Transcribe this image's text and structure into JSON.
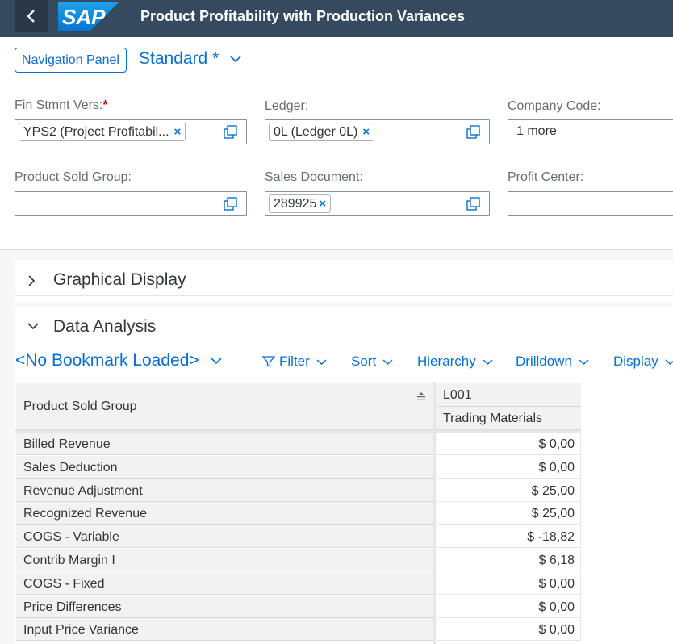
{
  "shell": {
    "back_icon": "chevron-left-icon",
    "logo_text": "SAP",
    "title": "Product Profitability with Production Variances"
  },
  "variant_bar": {
    "nav_panel_label": "Navigation Panel",
    "variant_name": "Standard *"
  },
  "filters": {
    "fin_stmnt": {
      "label": "Fin Stmnt Vers:",
      "required_mark": "*",
      "token": "YPS2 (Project Profitabil..."
    },
    "ledger": {
      "label": "Ledger:",
      "token": "0L (Ledger 0L)"
    },
    "company_code": {
      "label": "Company Code:",
      "value": "1 more"
    },
    "product_sold_group": {
      "label": "Product Sold Group:",
      "value": ""
    },
    "sales_document": {
      "label": "Sales Document:",
      "token": "289925"
    },
    "profit_center": {
      "label": "Profit Center:",
      "value": ""
    },
    "token_remove_glyph": "×"
  },
  "panels": {
    "graphical": "Graphical Display",
    "analysis": "Data Analysis"
  },
  "toolbar": {
    "bookmark": "<No Bookmark Loaded>",
    "filter": "Filter",
    "sort": "Sort",
    "hierarchy": "Hierarchy",
    "drilldown": "Drilldown",
    "display": "Display"
  },
  "grid": {
    "row_header": "Product Sold Group",
    "col_code": "L001",
    "col_name": "Trading Materials",
    "rows": [
      {
        "label": "Billed Revenue",
        "value": "$ 0,00"
      },
      {
        "label": "Sales Deduction",
        "value": "$ 0,00"
      },
      {
        "label": "Revenue Adjustment",
        "value": "$ 25,00"
      },
      {
        "label": "Recognized Revenue",
        "value": "$ 25,00"
      },
      {
        "label": "COGS - Variable",
        "value": "$ -18,82"
      },
      {
        "label": "Contrib Margin I",
        "value": "$ 6,18"
      },
      {
        "label": "COGS - Fixed",
        "value": "$ 0,00"
      },
      {
        "label": "Price Differences",
        "value": "$ 0,00"
      },
      {
        "label": "Input Price Variance",
        "value": "$ 0,00"
      }
    ]
  },
  "colors": {
    "shell": "#354a5f",
    "accent": "#0a6ed1",
    "required": "#bb0000",
    "header_cell": "#f2f2f2"
  }
}
